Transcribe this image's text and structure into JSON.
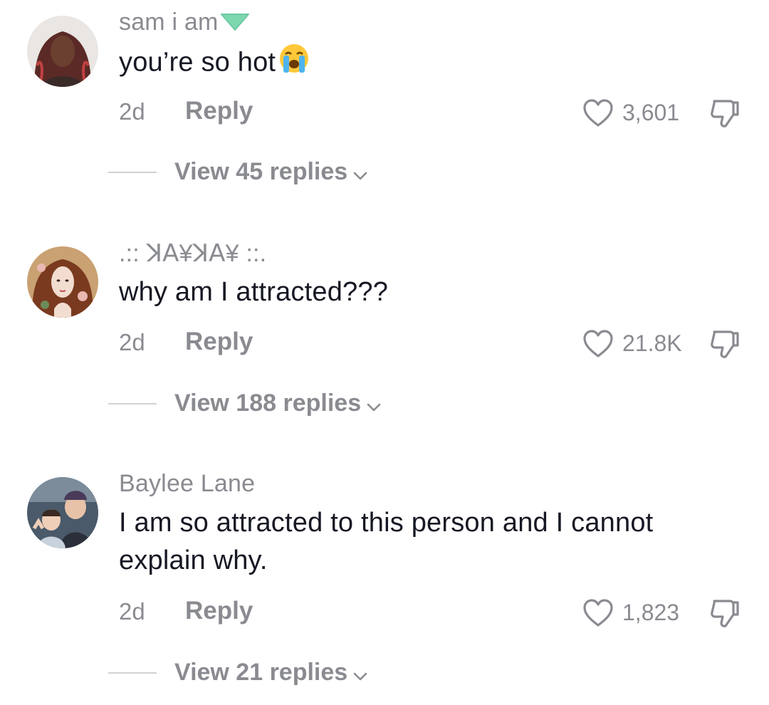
{
  "comments": [
    {
      "username": "sam i am",
      "badge_icon": "green-heart-icon",
      "text": "you’re so hot",
      "emoji_icon": "loudly-crying-face-icon",
      "time": "2d",
      "reply_label": "Reply",
      "likes": "3,601",
      "view_replies": "View 45 replies"
    },
    {
      "username": ".:: ꓘꓮ¥ꓘꓮ¥ ::.",
      "text": "why am I attracted???",
      "time": "2d",
      "reply_label": "Reply",
      "likes": "21.8K",
      "view_replies": "View 188 replies"
    },
    {
      "username": "Baylee Lane",
      "text": "I am so attracted to this person and I cannot explain why.",
      "time": "2d",
      "reply_label": "Reply",
      "likes": "1,823",
      "view_replies": "View 21 replies"
    }
  ],
  "icons": {
    "like": "heart-outline-icon",
    "dislike": "thumbs-down-outline-icon",
    "expand": "chevron-down-icon"
  },
  "colors": {
    "text_primary": "#161823",
    "text_secondary": "#8a8b91",
    "divider": "#d0d1d3",
    "badge": "#7dd8b0"
  }
}
